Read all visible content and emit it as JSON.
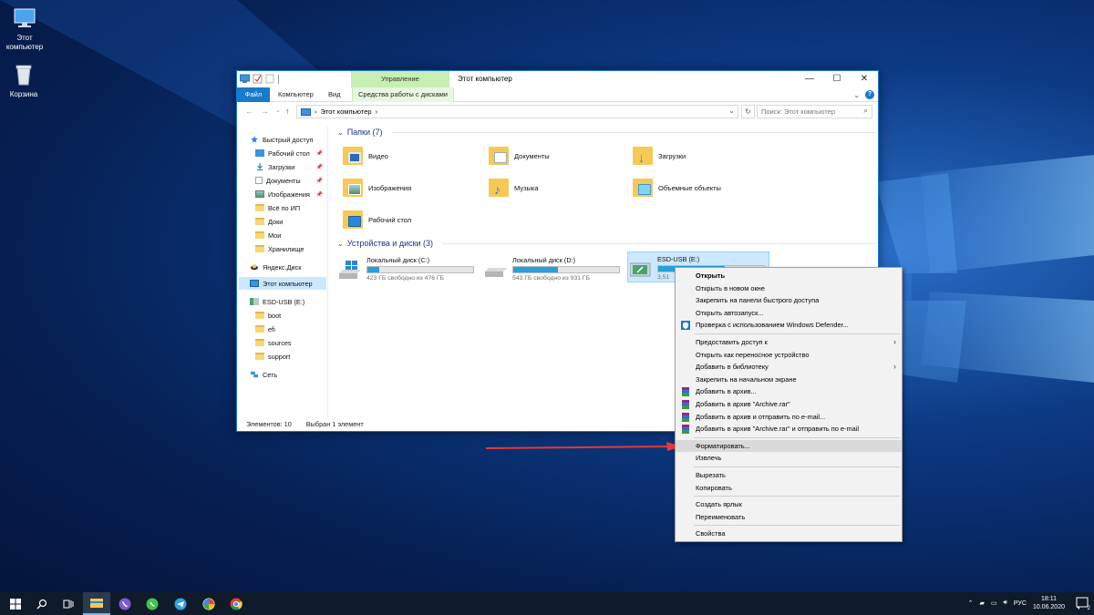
{
  "desktop": {
    "icons": [
      {
        "label": "Этот\nкомпьютер",
        "icon": "computer-icon"
      },
      {
        "label": "Корзина",
        "icon": "recycle-bin-icon"
      }
    ]
  },
  "window": {
    "title": "Этот компьютер",
    "manage_label": "Управление",
    "ribbon_tabs": {
      "file": "Файл",
      "computer": "Компьютер",
      "view": "Вид",
      "disk_tools": "Средства работы с дисками"
    },
    "controls": {
      "minimize": "—",
      "maximize": "☐",
      "close": "✕"
    },
    "address": {
      "path": "Этот компьютер",
      "separator": "›"
    },
    "search_placeholder": "Поиск: Этот компьютер",
    "nav": [
      {
        "label": "Быстрый доступ",
        "icon": "star-icon"
      },
      {
        "label": "Рабочий стол",
        "icon": "desktop-icon",
        "pinned": true
      },
      {
        "label": "Загрузки",
        "icon": "downloads-icon",
        "pinned": true
      },
      {
        "label": "Документы",
        "icon": "documents-icon",
        "pinned": true
      },
      {
        "label": "Изображения",
        "icon": "pictures-icon",
        "pinned": true
      },
      {
        "label": "Всё по ИП",
        "icon": "folder-icon"
      },
      {
        "label": "Доки",
        "icon": "folder-icon"
      },
      {
        "label": "Мои",
        "icon": "folder-icon"
      },
      {
        "label": "Хранилище",
        "icon": "folder-icon"
      },
      {
        "label": "Яндекс.Диск",
        "icon": "yandex-disk-icon"
      },
      {
        "label": "Этот компьютер",
        "icon": "computer-icon",
        "selected": true
      },
      {
        "label": "ESD-USB (E:)",
        "icon": "usb-drive-icon"
      },
      {
        "label": "boot",
        "icon": "folder-icon"
      },
      {
        "label": "efi",
        "icon": "folder-icon"
      },
      {
        "label": "sources",
        "icon": "folder-icon"
      },
      {
        "label": "support",
        "icon": "folder-icon"
      },
      {
        "label": "Сеть",
        "icon": "network-icon"
      }
    ],
    "folders_header": "Папки (7)",
    "folders": [
      {
        "label": "Видео",
        "icon": "video-folder-icon"
      },
      {
        "label": "Документы",
        "icon": "documents-folder-icon"
      },
      {
        "label": "Загрузки",
        "icon": "downloads-folder-icon"
      },
      {
        "label": "Изображения",
        "icon": "pictures-folder-icon"
      },
      {
        "label": "Музыка",
        "icon": "music-folder-icon"
      },
      {
        "label": "Объемные объекты",
        "icon": "3d-objects-folder-icon"
      },
      {
        "label": "Рабочий стол",
        "icon": "desktop-folder-icon"
      }
    ],
    "drives_header": "Устройства и диски (3)",
    "drives": [
      {
        "label": "Локальный диск (C:)",
        "free": "423 ГБ свободно из 476 ГБ",
        "used_fraction": 0.11,
        "icon": "windows-drive-icon"
      },
      {
        "label": "Локальный диск (D:)",
        "free": "543 ГБ свободно из 931 ГБ",
        "used_fraction": 0.42,
        "icon": "hard-drive-icon"
      },
      {
        "label": "ESD-USB (E:)",
        "free": "3,51",
        "used_fraction": 0.63,
        "icon": "usb-drive-icon",
        "selected": true
      }
    ],
    "status": {
      "count": "Элементов: 10",
      "selected": "Выбран 1 элемент"
    }
  },
  "context_menu": {
    "items": [
      {
        "label": "Открыть",
        "bold": true
      },
      {
        "label": "Открыть в новом окне"
      },
      {
        "label": "Закрепить на панели быстрого доступа"
      },
      {
        "label": "Открыть автозапуск..."
      },
      {
        "label": "Проверка с использованием Windows Defender...",
        "icon": "defender-icon"
      },
      {
        "sep": true
      },
      {
        "label": "Предоставить доступ к",
        "submenu": true
      },
      {
        "label": "Открыть как переносное устройство"
      },
      {
        "label": "Добавить в библиотеку",
        "submenu": true
      },
      {
        "label": "Закрепить на начальном экране"
      },
      {
        "label": "Добавить в архив...",
        "icon": "winrar-icon"
      },
      {
        "label": "Добавить в архив \"Archive.rar\"",
        "icon": "winrar-icon"
      },
      {
        "label": "Добавить в архив и отправить по e-mail...",
        "icon": "winrar-icon"
      },
      {
        "label": "Добавить в архив \"Archive.rar\" и отправить по e-mail",
        "icon": "winrar-icon"
      },
      {
        "sep": true
      },
      {
        "label": "Форматировать...",
        "highlighted": true
      },
      {
        "label": "Извлечь"
      },
      {
        "sep": true
      },
      {
        "label": "Вырезать"
      },
      {
        "label": "Копировать"
      },
      {
        "sep": true
      },
      {
        "label": "Создать ярлык"
      },
      {
        "label": "Переименовать"
      },
      {
        "sep": true
      },
      {
        "label": "Свойства"
      }
    ]
  },
  "taskbar": {
    "apps": [
      "start-icon",
      "search-icon",
      "task-view-icon",
      "file-explorer-icon",
      "viber-icon",
      "whatsapp-icon",
      "telegram-icon",
      "pinwheel-app-icon",
      "chrome-icon"
    ],
    "language": "РУС",
    "time": "18:11",
    "date": "10.06.2020",
    "notifications": "2"
  },
  "colors": {
    "accent": "#1979ca",
    "manage_tab": "#c6efb1",
    "selection": "#cce8ff",
    "arrow": "#e53935",
    "taskbar": "#101b2a"
  }
}
